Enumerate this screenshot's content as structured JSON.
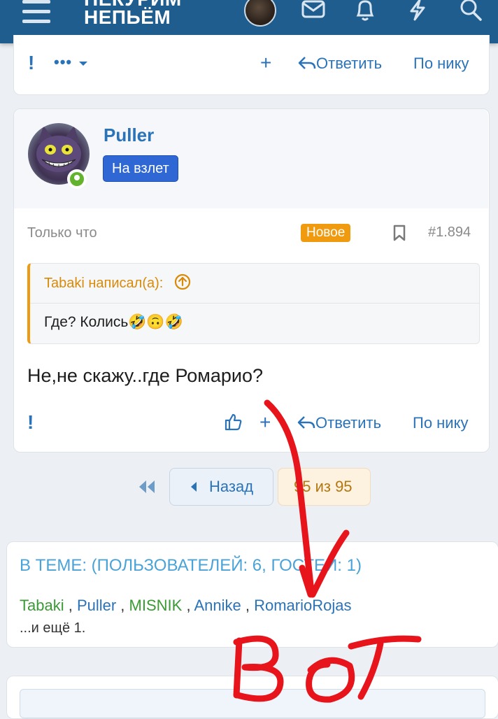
{
  "header": {
    "logo_line1": "НЕКУРИМ",
    "logo_line2": "НЕПЬЁМ",
    "icons": [
      "menu-icon",
      "avatar",
      "mail-icon",
      "bell-icon",
      "lightning-icon",
      "search-icon"
    ]
  },
  "prev_post": {
    "actions": {
      "report": "!",
      "more": "•••",
      "plus": "+",
      "reply": "Ответить",
      "by_nick": "По нику"
    }
  },
  "post": {
    "username": "Puller",
    "user_title": "На взлет",
    "time": "Только что",
    "new_label": "Новое",
    "number": "#1.894",
    "quote": {
      "author": "Tabaki написал(а):",
      "text": "Где? Колись🤣🙃🤣"
    },
    "text": "Не,не скажу..где Ромарио?",
    "actions": {
      "report": "!",
      "plus": "+",
      "reply": "Ответить",
      "by_nick": "По нику"
    }
  },
  "pagination": {
    "back": "Назад",
    "current": "95 из 95"
  },
  "online": {
    "title": "В ТЕМЕ: (ПОЛЬЗОВАТЕЛЕЙ: 6, ГОСТЕЙ: 1)",
    "users": [
      {
        "name": "Tabaki",
        "color": "#3a9a35"
      },
      {
        "name": "Puller",
        "color": "#2b73b8"
      },
      {
        "name": "MISNIK",
        "color": "#3a9a35"
      },
      {
        "name": "Annike",
        "color": "#2b73b8"
      },
      {
        "name": "RomarioRojas",
        "color": "#2b73b8"
      }
    ],
    "more": "...и ещё 1."
  },
  "annotation": {
    "handwritten": "Вот",
    "color": "#e8141b"
  },
  "colors": {
    "header": "#1f5d8e",
    "link": "#2b73b8",
    "new_badge": "#f09a10",
    "online_dot": "#63b32e"
  }
}
